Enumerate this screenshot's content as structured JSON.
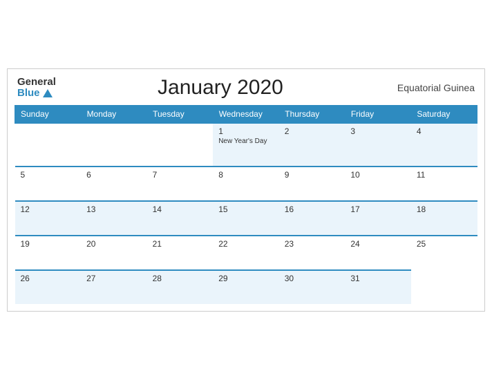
{
  "header": {
    "logo_general": "General",
    "logo_blue": "Blue",
    "title": "January 2020",
    "region": "Equatorial Guinea"
  },
  "weekdays": [
    "Sunday",
    "Monday",
    "Tuesday",
    "Wednesday",
    "Thursday",
    "Friday",
    "Saturday"
  ],
  "weeks": [
    [
      {
        "day": "",
        "holiday": ""
      },
      {
        "day": "",
        "holiday": ""
      },
      {
        "day": "",
        "holiday": ""
      },
      {
        "day": "1",
        "holiday": "New Year's Day"
      },
      {
        "day": "2",
        "holiday": ""
      },
      {
        "day": "3",
        "holiday": ""
      },
      {
        "day": "4",
        "holiday": ""
      }
    ],
    [
      {
        "day": "5",
        "holiday": ""
      },
      {
        "day": "6",
        "holiday": ""
      },
      {
        "day": "7",
        "holiday": ""
      },
      {
        "day": "8",
        "holiday": ""
      },
      {
        "day": "9",
        "holiday": ""
      },
      {
        "day": "10",
        "holiday": ""
      },
      {
        "day": "11",
        "holiday": ""
      }
    ],
    [
      {
        "day": "12",
        "holiday": ""
      },
      {
        "day": "13",
        "holiday": ""
      },
      {
        "day": "14",
        "holiday": ""
      },
      {
        "day": "15",
        "holiday": ""
      },
      {
        "day": "16",
        "holiday": ""
      },
      {
        "day": "17",
        "holiday": ""
      },
      {
        "day": "18",
        "holiday": ""
      }
    ],
    [
      {
        "day": "19",
        "holiday": ""
      },
      {
        "day": "20",
        "holiday": ""
      },
      {
        "day": "21",
        "holiday": ""
      },
      {
        "day": "22",
        "holiday": ""
      },
      {
        "day": "23",
        "holiday": ""
      },
      {
        "day": "24",
        "holiday": ""
      },
      {
        "day": "25",
        "holiday": ""
      }
    ],
    [
      {
        "day": "26",
        "holiday": ""
      },
      {
        "day": "27",
        "holiday": ""
      },
      {
        "day": "28",
        "holiday": ""
      },
      {
        "day": "29",
        "holiday": ""
      },
      {
        "day": "30",
        "holiday": ""
      },
      {
        "day": "31",
        "holiday": ""
      },
      {
        "day": "",
        "holiday": ""
      }
    ]
  ],
  "colors": {
    "header_bg": "#2E8BC0",
    "row_odd_bg": "#eaf4fb",
    "row_even_bg": "#ffffff"
  }
}
